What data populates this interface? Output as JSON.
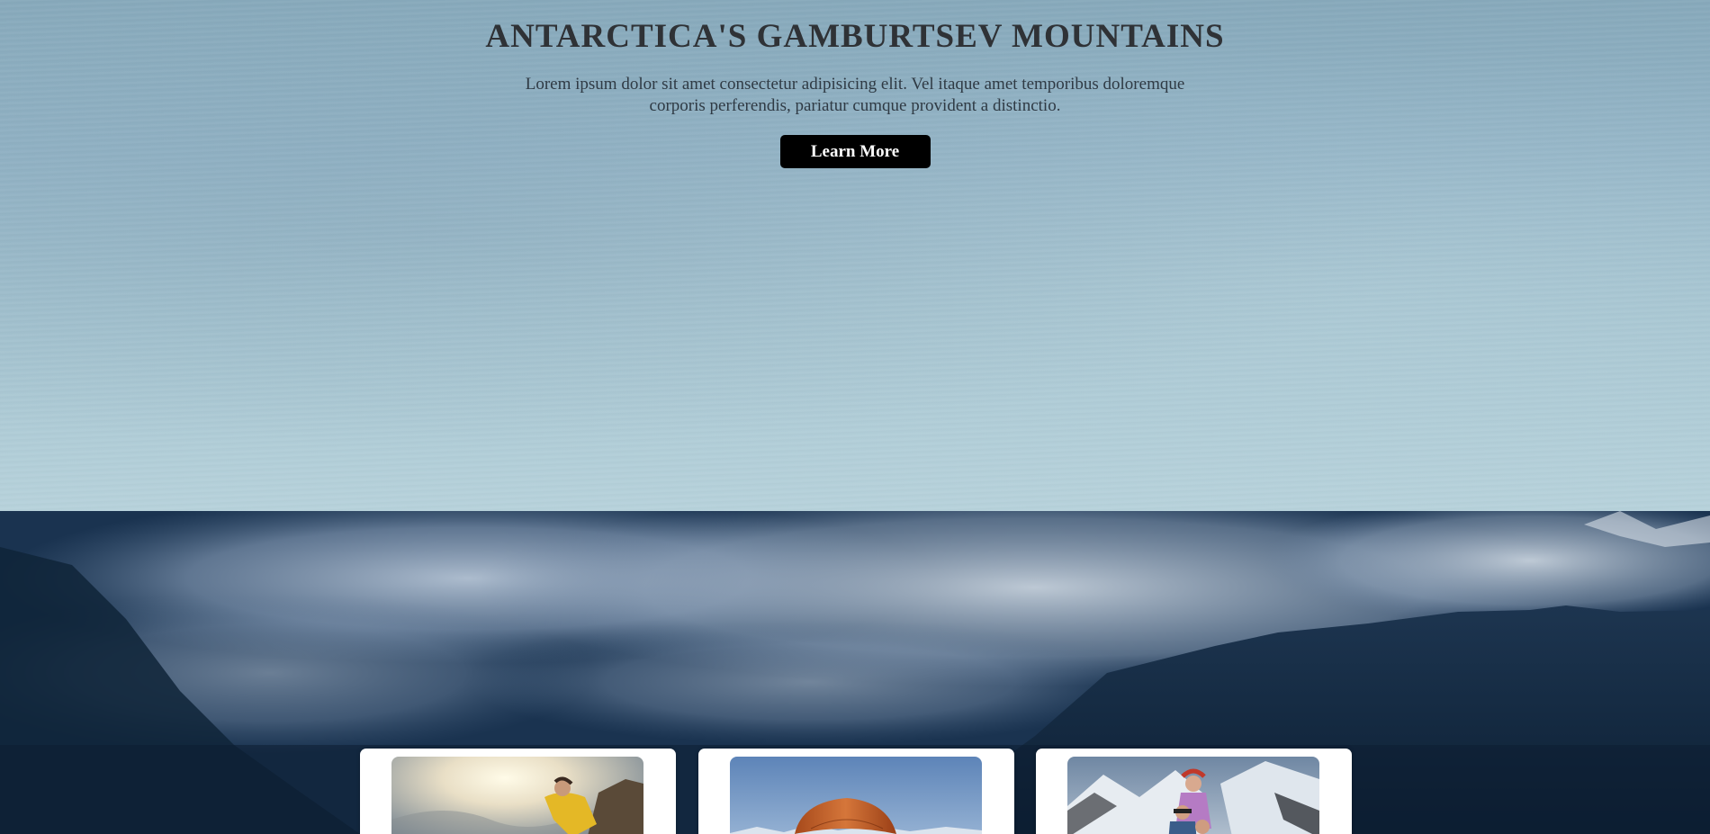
{
  "hero": {
    "title": "ANTARCTICA'S GAMBURTSEV MOUNTAINS",
    "text": "Lorem ipsum dolor sit amet consectetur adipisicing elit. Vel itaque amet temporibus doloremque corporis perferendis, pariatur cumque provident a distinctio.",
    "button_label": "Learn More"
  },
  "colors": {
    "button_bg": "#000000",
    "button_text": "#ffffff",
    "title_text": "#2f3236",
    "card_bg": "#ffffff"
  },
  "cards": [
    {
      "image_icon": "climber-image"
    },
    {
      "image_icon": "paraglider-image"
    },
    {
      "image_icon": "skiers-image"
    }
  ]
}
